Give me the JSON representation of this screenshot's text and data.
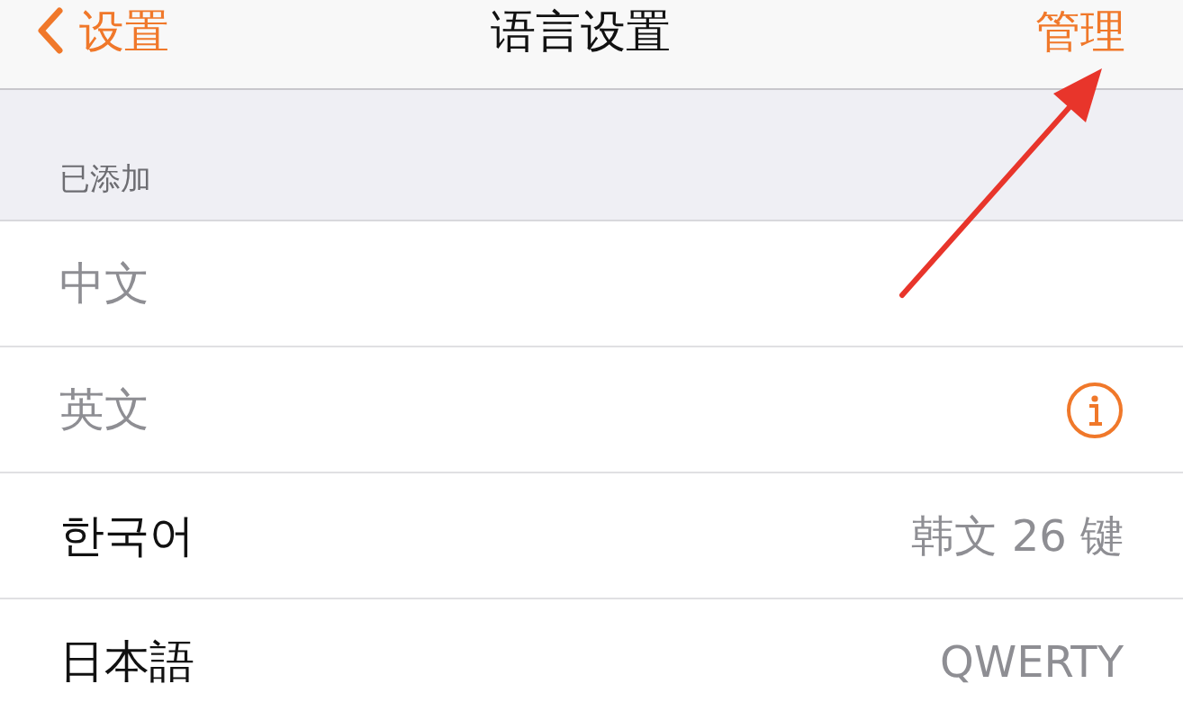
{
  "nav": {
    "back_label": "设置",
    "title": "语言设置",
    "action": "管理"
  },
  "section": {
    "header": "已添加"
  },
  "languages": [
    {
      "name": "中文",
      "disabled": true,
      "info": false
    },
    {
      "name": "英文",
      "disabled": true,
      "info": true
    },
    {
      "name": "한국어",
      "disabled": false,
      "info": false,
      "detail": "韩文 26 键"
    },
    {
      "name": "日本語",
      "disabled": false,
      "info": false,
      "detail": "QWERTY"
    }
  ],
  "annotation": {
    "kind": "arrow"
  }
}
